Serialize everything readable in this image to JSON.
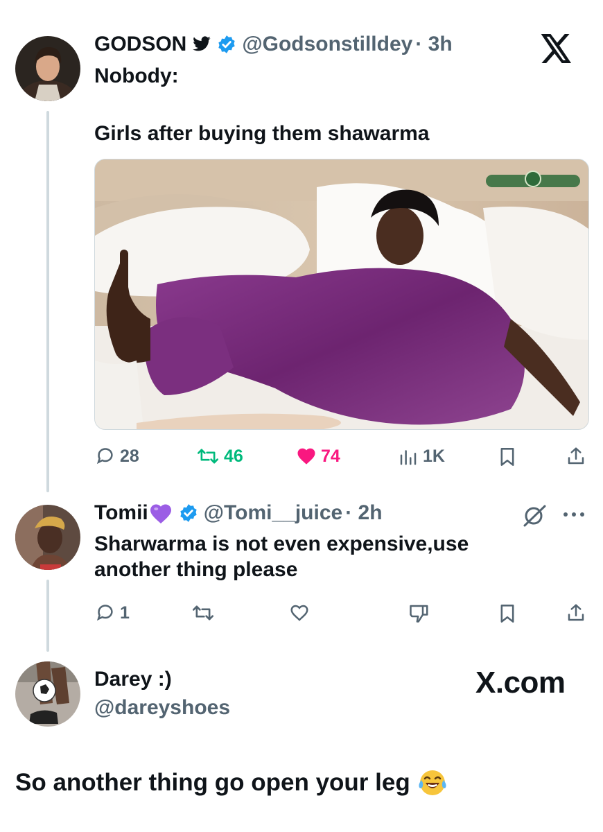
{
  "tweet": {
    "display_name": "GODSON",
    "handle": "@Godsonstilldey",
    "time": "· 3h",
    "line1": "Nobody:",
    "line2": "Girls after buying them shawarma",
    "image_watermark": "",
    "replies": "28",
    "retweets": "46",
    "likes": "74",
    "views": "1K"
  },
  "reply": {
    "display_name": "Tomii",
    "handle": "@Tomi__juice",
    "time": "· 2h",
    "text": "Sharwarma is not even expensive,use another thing please",
    "replies": "1"
  },
  "bottom_reply": {
    "display_name": "Darey :)",
    "handle": "@dareyshoes",
    "text": "So another thing go open your leg"
  },
  "x_brand_label": "X.com",
  "colors": {
    "verified": "#1d9bf0",
    "retweet": "#00ba7c",
    "like": "#f91880",
    "purple_heart": "#9b5de5"
  }
}
